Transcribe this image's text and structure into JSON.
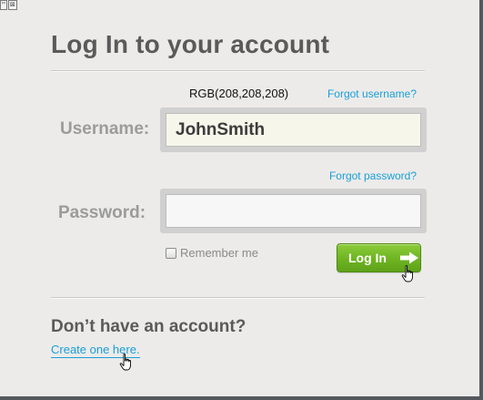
{
  "title": "Log In to your account",
  "rgb_note": "RGB(208,208,208)",
  "links": {
    "forgot_username": "Forgot username?",
    "forgot_password": "Forgot password?",
    "create_account": "Create one here."
  },
  "username": {
    "label": "Username:",
    "value": "JohnSmith"
  },
  "password": {
    "label": "Password:",
    "value": ""
  },
  "remember_me": {
    "label": "Remember me",
    "checked": false
  },
  "login_button": {
    "label": "Log In",
    "icon": "arrow-right-icon"
  },
  "no_account": "Don’t have an account?",
  "cursor_icon": "hand-pointer-icon",
  "colors": {
    "link": "#1a9fd8",
    "button": "#6eb422",
    "field_border": "#d0d0d0",
    "heading": "#5a5a5a",
    "label": "#9b9b9b"
  }
}
